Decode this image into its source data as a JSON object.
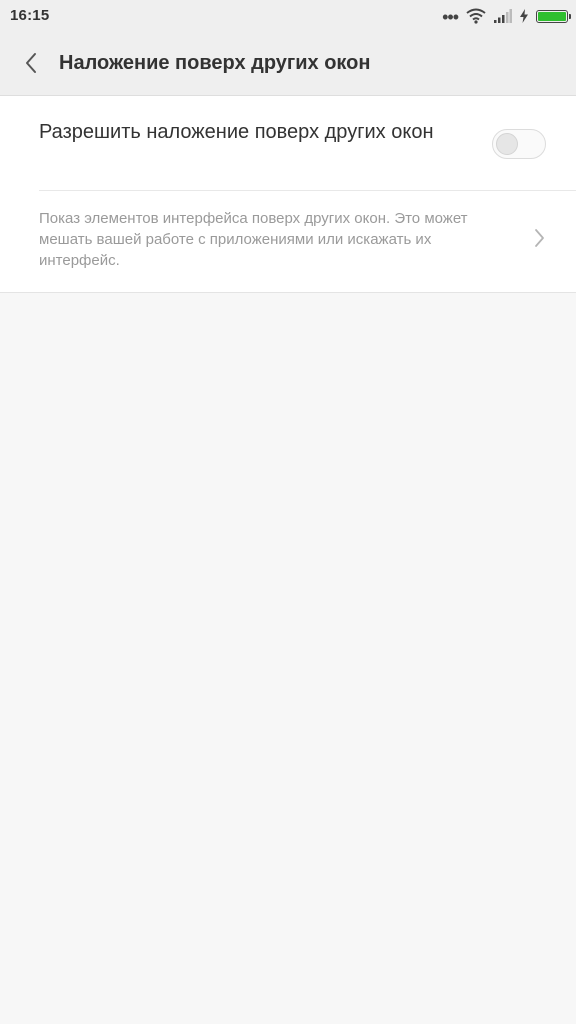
{
  "status_bar": {
    "time": "16:15",
    "dots": "•••",
    "icons": [
      "wifi-icon",
      "signal-icon",
      "charging-icon",
      "battery-icon"
    ],
    "battery_color": "#2fbf2f"
  },
  "header": {
    "title": "Наложение поверх других окон",
    "back_icon": "chevron-left-icon"
  },
  "settings": {
    "overlay_toggle": {
      "label": "Разрешить наложение поверх других окон",
      "enabled": false
    },
    "description": {
      "text": "Показ элементов интерфейса поверх других окон. Это может мешать вашей работе с приложениями или искажать их интерфейс.",
      "icon": "chevron-right-icon"
    }
  },
  "colors": {
    "background": "#f7f7f7",
    "header_bg": "#efefef",
    "card_bg": "#ffffff",
    "primary_text": "#333333",
    "secondary_text": "#9a9a9a"
  }
}
